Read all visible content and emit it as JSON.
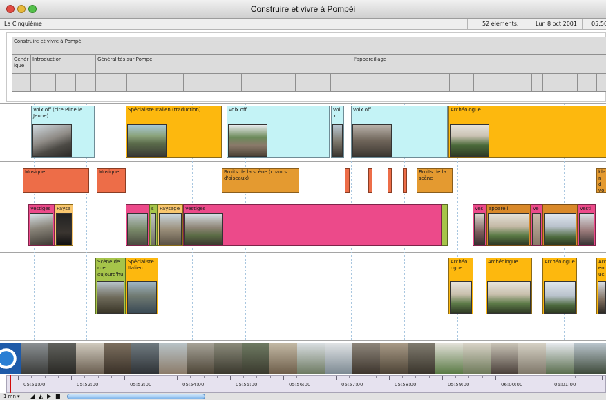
{
  "window": {
    "title": "Construire et vivre à Pompéi"
  },
  "infobar": {
    "channel": "La Cinquième",
    "count": "52 éléments.",
    "date": "Lun 8 oct 2001",
    "time": "05:50"
  },
  "outline": {
    "root": "Construire et vivre à Pompéi",
    "sections": [
      {
        "label": "Génér ique"
      },
      {
        "label": "Introduction"
      },
      {
        "label": "Généralités sur Pompéi"
      },
      {
        "label": "l'appareillage"
      }
    ]
  },
  "tracks": {
    "voice": [
      {
        "label": "Voix off (cite Pline le Jeune)",
        "color": "#c4f3f6"
      },
      {
        "label": "Spécialiste Italien (traduction)",
        "color": "#fdb80e"
      },
      {
        "label": "voix off",
        "color": "#c4f3f6"
      },
      {
        "label": "voi x",
        "color": "#c4f3f6"
      },
      {
        "label": "voix off",
        "color": "#c4f3f6"
      },
      {
        "label": "Archéologue",
        "color": "#fdb80e"
      }
    ],
    "sound": [
      {
        "label": "Musique",
        "color": "#ed6d48"
      },
      {
        "label": "Musique",
        "color": "#ed6d48"
      },
      {
        "label": "Bruits de la scène (chants d'oiseaux)",
        "color": "#e49a30"
      },
      {
        "label": "Bruits de la scène",
        "color": "#e49a30"
      },
      {
        "label": "kla n d voi",
        "color": "#e49a30"
      }
    ],
    "images": [
      {
        "label": "Vestiges"
      },
      {
        "label": "Paysa"
      },
      {
        "label": "s"
      },
      {
        "label": "Paysage"
      },
      {
        "label": "Vestiges"
      },
      {
        "label": "Ves"
      },
      {
        "label": "appareil"
      },
      {
        "label": "Ve"
      },
      {
        "label": "Vesti"
      }
    ],
    "people": [
      {
        "label": "Scène de rue aujourd'hui"
      },
      {
        "label": "Spécialiste Italien"
      },
      {
        "label": "Archéol ogue"
      },
      {
        "label": "Archéologue"
      },
      {
        "label": "Archéologue"
      },
      {
        "label": "Arc éol ue"
      }
    ]
  },
  "ruler": {
    "labels": [
      "05:51:00",
      "05:52:00",
      "05:53:00",
      "05:54:00",
      "05:55:00",
      "05:56:00",
      "05:57:00",
      "05:58:00",
      "05:59:00",
      "06:00:00",
      "06:01:00"
    ]
  },
  "bottombar": {
    "zoom": "1 mn"
  }
}
